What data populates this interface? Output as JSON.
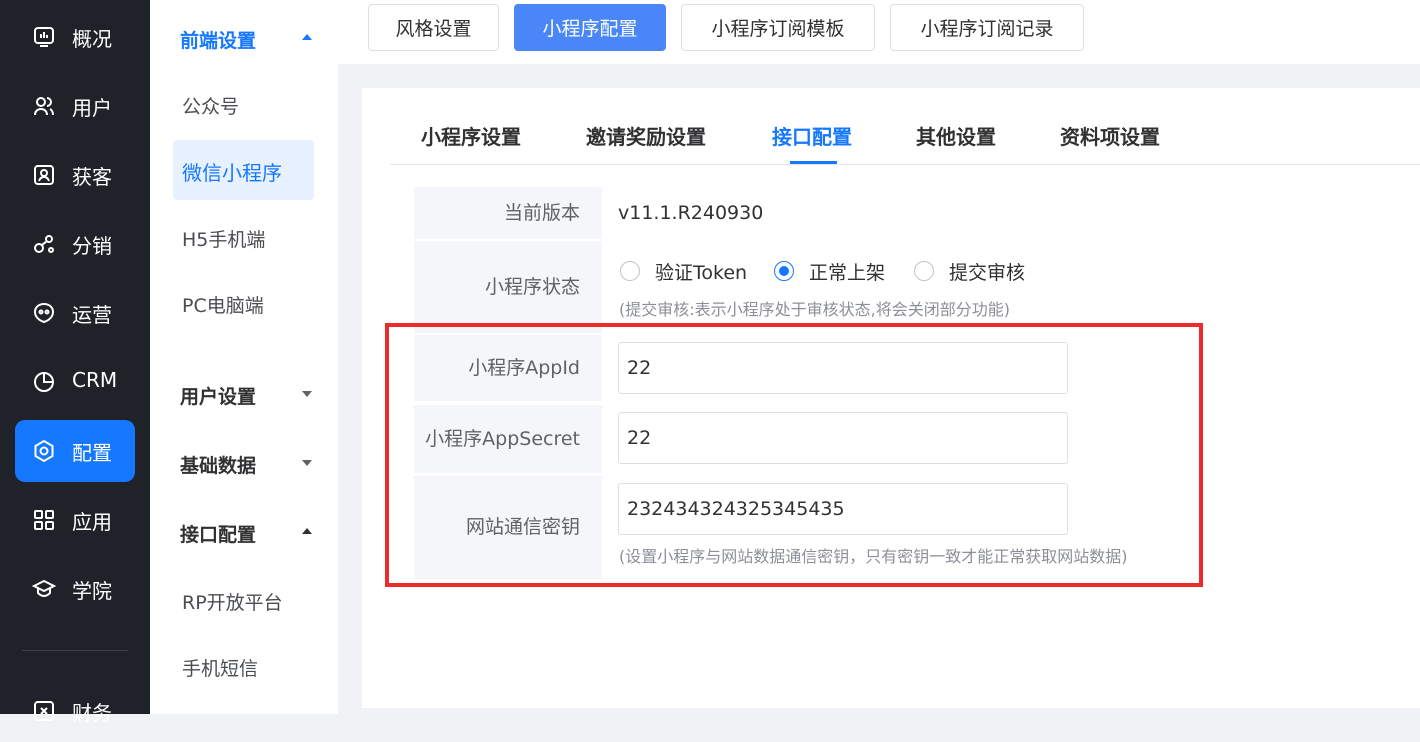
{
  "sidebar": {
    "items": [
      {
        "label": "概况",
        "icon": "dashboard-icon"
      },
      {
        "label": "用户",
        "icon": "users-icon"
      },
      {
        "label": "获客",
        "icon": "customer-icon"
      },
      {
        "label": "分销",
        "icon": "distribution-icon"
      },
      {
        "label": "运营",
        "icon": "operations-icon"
      },
      {
        "label": "CRM",
        "icon": "crm-icon"
      },
      {
        "label": "配置",
        "icon": "settings-icon",
        "active": true
      },
      {
        "label": "应用",
        "icon": "apps-icon"
      },
      {
        "label": "学院",
        "icon": "academy-icon"
      },
      {
        "label": "财务",
        "icon": "finance-icon"
      }
    ]
  },
  "submenu": {
    "group_frontend": "前端设置",
    "item_official": "公众号",
    "item_miniapp": "微信小程序",
    "item_h5": "H5手机端",
    "item_pc": "PC电脑端",
    "group_user": "用户设置",
    "group_basic": "基础数据",
    "group_api": "接口配置",
    "item_rp": "RP开放平台",
    "item_sms": "手机短信"
  },
  "top_tabs": [
    "风格设置",
    "小程序配置",
    "小程序订阅模板",
    "小程序订阅记录"
  ],
  "sub_tabs": [
    "小程序设置",
    "邀请奖励设置",
    "接口配置",
    "其他设置",
    "资料项设置"
  ],
  "form": {
    "version_label": "当前版本",
    "version_value": "v11.1.R240930",
    "status_label": "小程序状态",
    "status_options": [
      "验证Token",
      "正常上架",
      "提交审核"
    ],
    "status_selected": "正常上架",
    "status_hint": "(提交审核:表示小程序处于审核状态,将会关闭部分功能)",
    "appid_label": "小程序AppId",
    "appid_value": "22",
    "secret_label": "小程序AppSecret",
    "secret_value": "22",
    "key_label": "网站通信密钥",
    "key_value": "232434324325345435",
    "key_hint": "(设置小程序与网站数据通信密钥，只有密钥一致才能正常获取网站数据)"
  },
  "colors": {
    "accent": "#1677ff",
    "sidebar_bg": "#1f2329",
    "highlight": "#ee2b2b"
  }
}
